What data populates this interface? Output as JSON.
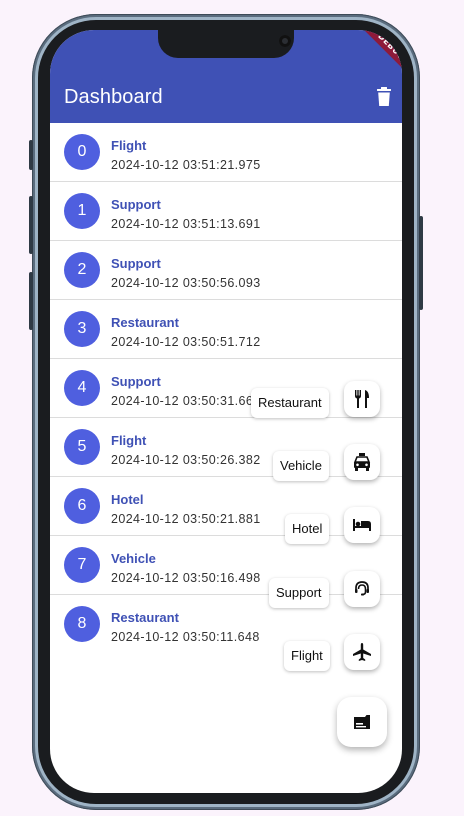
{
  "appbar": {
    "title": "Dashboard",
    "color": "#3f51b5"
  },
  "debug_banner": "DEBUG",
  "entries": [
    {
      "index": "0",
      "category": "Flight",
      "timestamp": "2024-10-12 03:51:21.975"
    },
    {
      "index": "1",
      "category": "Support",
      "timestamp": "2024-10-12 03:51:13.691"
    },
    {
      "index": "2",
      "category": "Support",
      "timestamp": "2024-10-12 03:50:56.093"
    },
    {
      "index": "3",
      "category": "Restaurant",
      "timestamp": "2024-10-12 03:50:51.712"
    },
    {
      "index": "4",
      "category": "Support",
      "timestamp": "2024-10-12 03:50:31.66"
    },
    {
      "index": "5",
      "category": "Flight",
      "timestamp": "2024-10-12 03:50:26.382"
    },
    {
      "index": "6",
      "category": "Hotel",
      "timestamp": "2024-10-12 03:50:21.881"
    },
    {
      "index": "7",
      "category": "Vehicle",
      "timestamp": "2024-10-12 03:50:16.498"
    },
    {
      "index": "8",
      "category": "Restaurant",
      "timestamp": "2024-10-12 03:50:11.648"
    }
  ],
  "speed_dial": {
    "actions": [
      {
        "label": "Restaurant",
        "icon": "restaurant-icon"
      },
      {
        "label": "Vehicle",
        "icon": "local-taxi-icon"
      },
      {
        "label": "Hotel",
        "icon": "hotel-bed-icon"
      },
      {
        "label": "Support",
        "icon": "support-agent-icon"
      },
      {
        "label": "Flight",
        "icon": "airplane-icon"
      }
    ],
    "main_icon": "receipt-card-icon"
  },
  "colors": {
    "avatar": "#4f5fdf",
    "title": "#3f51b5",
    "background": "#fbf3fc"
  }
}
